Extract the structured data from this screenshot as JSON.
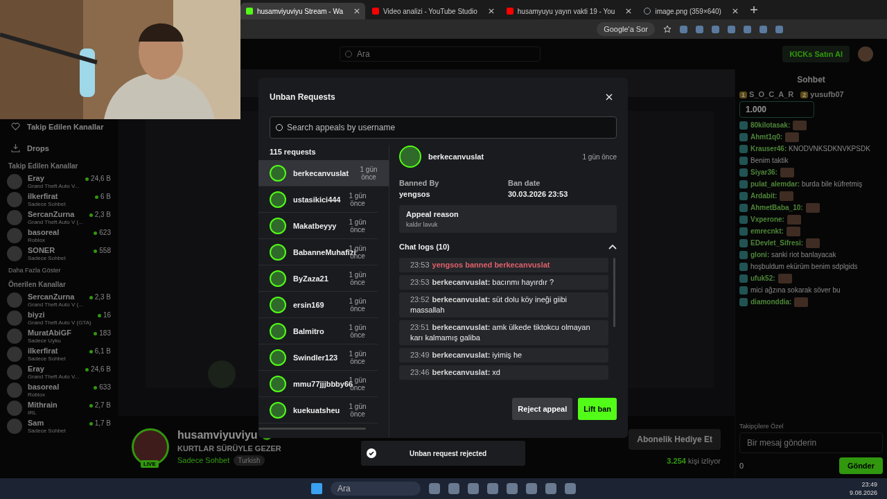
{
  "browser": {
    "tabs": [
      {
        "title": "husamviyuviyu Stream - Wa",
        "selected": true,
        "kind": "kick"
      },
      {
        "title": "Video analizi - YouTube Studio",
        "selected": false,
        "kind": "youtube"
      },
      {
        "title": "husamyuyu yayın vakti 19 - You",
        "selected": false,
        "kind": "youtube"
      },
      {
        "title": "image.png (359×640)",
        "selected": false,
        "kind": "globe"
      }
    ],
    "ask_button": "Google'a Sor"
  },
  "header": {
    "search_placeholder": "Ara",
    "kicks_button": "KICKs Satın Al"
  },
  "sidebar": {
    "nav": [
      {
        "label": "Takip Edilen Kanallar",
        "kind": "heart"
      },
      {
        "label": "Drops",
        "kind": "drops"
      }
    ],
    "followed_title": "Takip Edilen Kanallar",
    "followed": [
      {
        "name": "Eray",
        "sub": "Grand Theft Auto V...",
        "viewers": "24,6 B"
      },
      {
        "name": "ilkerfirat",
        "sub": "Sadece Sohbet",
        "viewers": "6 B"
      },
      {
        "name": "SercanZurna",
        "sub": "Grand Theft Auto V (...",
        "viewers": "2,3 B"
      },
      {
        "name": "basoreal",
        "sub": "Roblox",
        "viewers": "623"
      },
      {
        "name": "SONER",
        "sub": "Sadece Sohbet",
        "viewers": "558"
      }
    ],
    "show_more": "Daha Fazla Göster",
    "recommended_title": "Önerilen Kanallar",
    "recommended": [
      {
        "name": "SercanZurna",
        "sub": "Grand Theft Auto V (...",
        "viewers": "2,3 B"
      },
      {
        "name": "biyzi",
        "sub": "Grand Theft Auto V (GTA)",
        "viewers": "16"
      },
      {
        "name": "MuratAbiGF",
        "sub": "Sadece Uyku",
        "viewers": "183"
      },
      {
        "name": "ilkerfirat",
        "sub": "Sadece Sohbet",
        "viewers": "6,1 B"
      },
      {
        "name": "Eray",
        "sub": "Grand Theft Auto V...",
        "viewers": "24,6 B"
      },
      {
        "name": "basoreal",
        "sub": "Roblox",
        "viewers": "633"
      },
      {
        "name": "Mithrain",
        "sub": "IRL",
        "viewers": "2,7 B"
      },
      {
        "name": "Sam",
        "sub": "Sadece Sohbet",
        "viewers": "1,7 B"
      }
    ]
  },
  "stream_info": {
    "channel": "husamviyuviyu",
    "live_badge": "LIVE",
    "title": "KURTLAR SÜRÜYLE GEZER",
    "category": "Sadece Sohbet",
    "language": "Turkish",
    "gift_button": "Abonelik Hediye Et",
    "viewers": "3.254",
    "viewers_label": "kişi izliyor"
  },
  "chat": {
    "title": "Sohbet",
    "leaders": [
      {
        "rank": "1",
        "name": "S_O_C_A_R"
      },
      {
        "rank": "2",
        "name": "yusufb07"
      }
    ],
    "pinned_amount": "1.000",
    "messages": [
      {
        "user": "80kilotasak:",
        "emote": true
      },
      {
        "user": "Ahmt1q0:",
        "emote": true
      },
      {
        "user": "Krauser46:",
        "text": "KNODVNKSDKNVKPSDK",
        "emote": false
      },
      {
        "text": "Benim taktik",
        "emote": false
      },
      {
        "user": "Siyar36:",
        "emote": true
      },
      {
        "user": "pulat_alemdar:",
        "text": "burda bile küfretmiş",
        "emote": false
      },
      {
        "user": "Ardabit:",
        "emote": true
      },
      {
        "user": "AhmetBaba_10:",
        "emote": true
      },
      {
        "user": "Vxperone:",
        "emote": true
      },
      {
        "user": "emrecnkt:",
        "emote": true
      },
      {
        "user": "EDevlet_Sifresi:",
        "emote": true
      },
      {
        "user": "gloni:",
        "text": "sanki riot banlayacak",
        "emote": false
      },
      {
        "text": "hoşbuldum ekürüm benim sdplgids",
        "emote": false
      },
      {
        "user": "ufuk52:",
        "emote": true
      },
      {
        "text": "mici ağzına sokarak söver bu",
        "emote": false
      },
      {
        "user": "diamonddia:",
        "emote": true
      }
    ],
    "followers_only": "Takipçilere Özel",
    "input_placeholder": "Bir mesaj gönderin",
    "points": "0",
    "send_button": "Gönder"
  },
  "modal": {
    "title": "Unban Requests",
    "search_placeholder": "Search appeals by username",
    "count": "115 requests",
    "requests": [
      {
        "name": "berkecanvuslat",
        "time": "1 gün önce",
        "selected": true
      },
      {
        "name": "ustasikici444",
        "time": "1 gün önce",
        "selected": false
      },
      {
        "name": "Makatbeyyy",
        "time": "1 gün önce",
        "selected": false
      },
      {
        "name": "BabanneMuhafizi",
        "time": "1 gün önce",
        "selected": false
      },
      {
        "name": "ByZaza21",
        "time": "1 gün önce",
        "selected": false
      },
      {
        "name": "ersin169",
        "time": "1 gün önce",
        "selected": false
      },
      {
        "name": "Balmitro",
        "time": "1 gün önce",
        "selected": false
      },
      {
        "name": "Swindler123",
        "time": "1 gün önce",
        "selected": false
      },
      {
        "name": "mmu77jjjbbby66",
        "time": "1 gün önce",
        "selected": false
      },
      {
        "name": "kuekuatsheu",
        "time": "1 gün önce",
        "selected": false
      }
    ],
    "detail": {
      "name": "berkecanvuslat",
      "time": "1 gün önce",
      "banned_by_label": "Banned By",
      "banned_by": "yengsos",
      "ban_date_label": "Ban date",
      "ban_date": "30.03.2026 23:53",
      "reason_label": "Appeal reason",
      "reason": "kaldır lavuk",
      "logs_title": "Chat logs (10)",
      "logs_expanded": true,
      "logs": [
        {
          "time": "23:53",
          "kind": "ban",
          "text": "yengsos banned berkecanvuslat"
        },
        {
          "time": "23:53",
          "kind": "message",
          "user": "berkecanvuslat:",
          "text": "bacınmı hayırdır ?"
        },
        {
          "time": "23:52",
          "kind": "message",
          "user": "berkecanvuslat:",
          "text": "süt dolu köy ineği giibi massallah"
        },
        {
          "time": "23:51",
          "kind": "message",
          "user": "berkecanvuslat:",
          "text": "amk ülkede tiktokcu olmayan karı kalmamış galiba"
        },
        {
          "time": "23:49",
          "kind": "message",
          "user": "berkecanvuslat:",
          "text": "iyimiş he"
        },
        {
          "time": "23:46",
          "kind": "message",
          "user": "berkecanvuslat:",
          "text": "xd"
        }
      ]
    },
    "reject_button": "Reject appeal",
    "lift_button": "Lift ban"
  },
  "toast": "Unban request rejected",
  "taskbar": {
    "search_placeholder": "Ara",
    "time": "23:49",
    "date": "9.08.2026"
  }
}
